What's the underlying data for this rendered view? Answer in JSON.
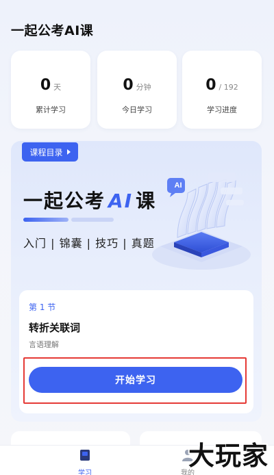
{
  "app": {
    "title": "一起公考AI课"
  },
  "stats": [
    {
      "value": "0",
      "unit": "天",
      "label": "累计学习"
    },
    {
      "value": "0",
      "unit": "分钟",
      "label": "今日学习"
    },
    {
      "value": "0",
      "unit": "/ 192",
      "label": "学习进度"
    }
  ],
  "course": {
    "catalog_label": "课程目录",
    "hero_title_pre": "一起公考",
    "hero_title_ai": "AI",
    "hero_title_post": "课",
    "hero_subtitle": "入门 | 锦囊 | 技巧 | 真题",
    "illustration_badge": "AI",
    "lesson": {
      "number": "第 1 节",
      "title": "转折关联词",
      "category": "言语理解",
      "start_label": "开始学习"
    }
  },
  "tabs": [
    {
      "label": "学习",
      "icon": "book-icon",
      "active": true
    },
    {
      "label": "我的",
      "icon": "person-icon",
      "active": false
    }
  ],
  "watermark": "大玩家",
  "colors": {
    "accent": "#3d63f0",
    "highlight": "#e53935"
  }
}
